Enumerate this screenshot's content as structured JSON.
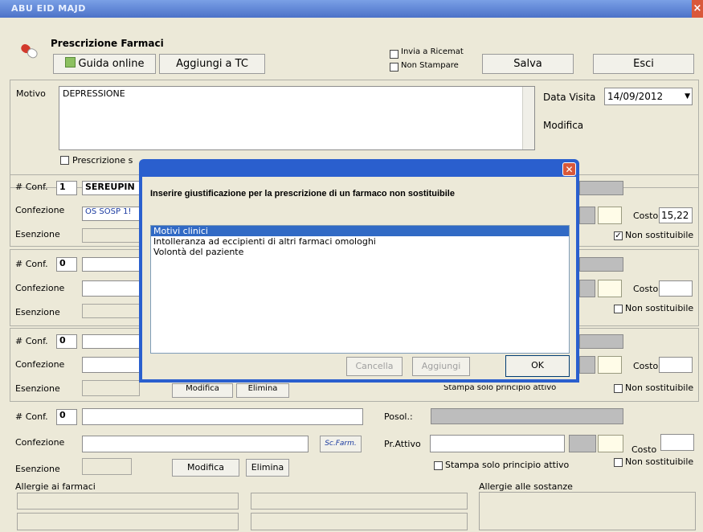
{
  "window": {
    "title": "ABU EID MAJD",
    "close": "×"
  },
  "header": {
    "title": "Prescrizione Farmaci",
    "guida_label": "Guida online",
    "aggiungi_tc_label": "Aggiungi a TC",
    "invia_ricemat_label": "Invia a Ricemat",
    "non_stampare_label": "Non Stampare",
    "salva_label": "Salva",
    "esci_label": "Esci"
  },
  "motivo": {
    "label": "Motivo",
    "value": "DEPRESSIONE",
    "data_visita_label": "Data Visita",
    "data_visita_value": "14/09/2012",
    "modifica_label": "Modifica",
    "prescrizione_label": "Prescrizione s"
  },
  "blocks": [
    {
      "conf_label": "# Conf.",
      "conf_value": "1",
      "farmaco": "SEREUPIN",
      "confezione_label": "Confezione",
      "confezione_value": "OS SOSP 1!",
      "esenzione_label": "Esenzione",
      "costo_label": "Costo",
      "costo_value": "15,22",
      "non_sost_label": "Non sostituibile",
      "non_sost_checked": true
    },
    {
      "conf_label": "# Conf.",
      "conf_value": "0",
      "confezione_label": "Confezione",
      "esenzione_label": "Esenzione",
      "costo_label": "Costo",
      "costo_value": "",
      "non_sost_label": "Non sostituibile",
      "non_sost_checked": false
    },
    {
      "conf_label": "# Conf.",
      "conf_value": "0",
      "confezione_label": "Confezione",
      "esenzione_label": "Esenzione",
      "costo_label": "Costo",
      "costo_value": "",
      "non_sost_label": "Non sostituibile",
      "non_sost_checked": false,
      "modifica_label": "Modifica",
      "elimina_label": "Elimina",
      "stampa_label": "Stampa solo principio attivo"
    },
    {
      "conf_label": "# Conf.",
      "conf_value": "0",
      "confezione_label": "Confezione",
      "esenzione_label": "Esenzione",
      "posol_label": "Posol.:",
      "pr_attivo_label": "Pr.Attivo",
      "sc_farm_label": "Sc.Farm.",
      "modifica_label": "Modifica",
      "elimina_label": "Elimina",
      "stampa_label": "Stampa solo principio attivo",
      "costo_label": "Costo",
      "costo_value": "",
      "non_sost_label": "Non sostituibile",
      "non_sost_checked": false
    }
  ],
  "allergie": {
    "farmaci_label": "Allergie ai farmaci",
    "sostanze_label": "Allergie alle sostanze"
  },
  "dialog": {
    "title": "",
    "message": "Inserire giustificazione per la prescrizione di un farmaco non sostituibile",
    "options": [
      "Motivi clinici",
      "Intolleranza ad eccipienti di altri farmaci omologhi",
      "Volontà del paziente"
    ],
    "selected_index": 0,
    "cancella_label": "Cancella",
    "aggiungi_label": "Aggiungi",
    "ok_label": "OK"
  },
  "colors": {
    "titlebar": "#4c72c8",
    "dialog_frame": "#2a5fce",
    "selection": "#316ac5",
    "window_bg": "#ece9d8"
  }
}
